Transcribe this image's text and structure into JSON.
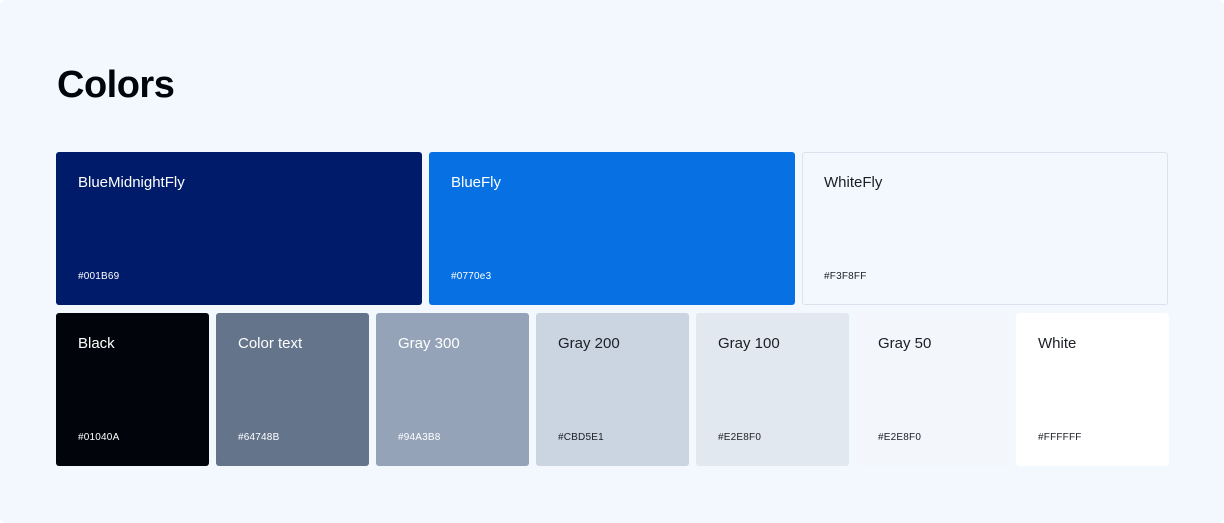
{
  "title": "Colors",
  "primary": [
    {
      "name": "BlueMidnightFly",
      "hex": "#001B69",
      "color": "#001B69",
      "text": "light"
    },
    {
      "name": "BlueFly",
      "hex": "#0770e3",
      "color": "#0770E3",
      "text": "light"
    },
    {
      "name": "WhiteFly",
      "hex": "#F3F8FF",
      "color": "#F3F8FF",
      "text": "dark"
    }
  ],
  "neutrals": [
    {
      "name": "Black",
      "hex": "#01040A",
      "color": "#01040A",
      "text": "light"
    },
    {
      "name": "Color text",
      "hex": "#64748B",
      "color": "#64748B",
      "text": "light"
    },
    {
      "name": "Gray 300",
      "hex": "#94A3B8",
      "color": "#94A3B8",
      "text": "light"
    },
    {
      "name": "Gray 200",
      "hex": "#CBD5E1",
      "color": "#CBD5E1",
      "text": "dark"
    },
    {
      "name": "Gray 100",
      "hex": "#E2E8F0",
      "color": "#E2E8F0",
      "text": "dark"
    },
    {
      "name": "Gray 50",
      "hex": "#E2E8F0",
      "color": "#F3F6FA",
      "text": "dark"
    },
    {
      "name": "White",
      "hex": "#FFFFFF",
      "color": "#FFFFFF",
      "text": "dark"
    }
  ]
}
